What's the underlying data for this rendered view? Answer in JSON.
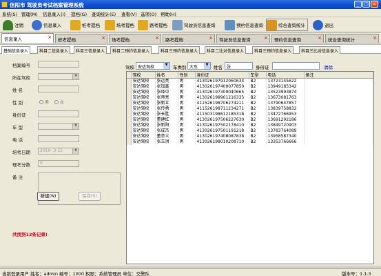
{
  "window": {
    "title": "信阳市  驾驶员考试档案管理系统"
  },
  "menu": [
    "系统(S)",
    "管理(M)",
    "信息录入(I)",
    "提档(G)",
    "查询统计(E)",
    "查看(V)",
    "选项(O)",
    "帮助(H)"
  ],
  "toolbar": [
    {
      "label": "注销",
      "icon": "logout-user-icon",
      "color": "#3d7d2a"
    },
    {
      "label": "信息录入",
      "icon": "user-entry-icon",
      "color": "#3a6fd1"
    },
    {
      "label": "桩考提档",
      "icon": "folder-icon",
      "color": "#e0a91f"
    },
    {
      "label": "场考提档",
      "icon": "folder-icon",
      "color": "#e0a91f"
    },
    {
      "label": "路考提档",
      "icon": "folder-icon",
      "color": "#e0a91f"
    },
    {
      "label": "驾驶员信息查询",
      "icon": "search-document-icon",
      "color": "#7b9ec2"
    },
    {
      "label": "预约信息查询",
      "icon": "calendar-icon",
      "color": "#5e8fbf"
    },
    {
      "label": "综合查询统计",
      "icon": "grid-stats-icon",
      "color": "#d99323"
    },
    {
      "label": "退出",
      "icon": "exit-icon",
      "color": "#2b62c8"
    }
  ],
  "main_tabs": [
    "信息录入",
    "桩考提档",
    "场考提档",
    "路考提档",
    "驾驶员信息查询",
    "预约信息查询",
    "统合查询统计"
  ],
  "sub_tabs": [
    "基础信息录入",
    "科目二信息录入",
    "科目三信息录入",
    "科目二预约信息录入",
    "科目三预约信息录入",
    "科目二比对信息录入",
    "科目三预约信息录入",
    "科目三比对信息录入"
  ],
  "form": {
    "labels": [
      "档案编号",
      "所在驾校",
      "姓    名",
      "性    别",
      "身份证",
      "车    型",
      "电    话",
      "培考日期",
      "理考分数",
      "备    注"
    ],
    "gender_male": "男",
    "gender_female": "女",
    "date_value": "2010- 3-15",
    "score_value": "0",
    "new_button": "新建(N)",
    "save_button": "保存(S)",
    "record_count": "共找到12条记录!"
  },
  "filter": {
    "school_label": "驾校",
    "school_value": "安达驾校",
    "cartype_label": "车类别",
    "cartype_value": "大车",
    "name_label": "姓名",
    "name_value": "张",
    "idcard_label": "身份证",
    "clear_label": "清除"
  },
  "grid": {
    "columns": [
      "驾校",
      "姓名",
      "性别",
      "身份证",
      "车型",
      "电话",
      "备注"
    ],
    "rows": [
      [
        "安达驾校",
        "张运亮",
        "男",
        "413026197912060634",
        "B2",
        "13723145622",
        ""
      ],
      [
        "安达驾校",
        "张加鑫",
        "男",
        "413026197409077850",
        "B2",
        "13949185342",
        ""
      ],
      [
        "安达驾校",
        "张绎中",
        "男",
        "413026197309040665",
        "B2",
        "13523993874",
        ""
      ],
      [
        "安达驾校",
        "张师亮",
        "男",
        "413026198901216335",
        "B2",
        "13673081763",
        ""
      ],
      [
        "安达驾校",
        "张新立",
        "男",
        "411526198706274211",
        "B2",
        "13790647857",
        ""
      ],
      [
        "安达驾校",
        "张传勇",
        "男",
        "411526198711234271",
        "B2",
        "13839758832",
        ""
      ],
      [
        "安达驾校",
        "张长胜",
        "男",
        "411503198612185318",
        "B2",
        "13472766953",
        ""
      ],
      [
        "安达驾校",
        "董建红",
        "男",
        "413026197506227630",
        "B2",
        "13691292186",
        ""
      ],
      [
        "安达驾校",
        "张新阳",
        "男",
        "413026197502178410",
        "B2",
        "13849720903",
        ""
      ],
      [
        "安达驾校",
        "张成杰",
        "男",
        "413026197501191218",
        "B2",
        "13783764089",
        ""
      ],
      [
        "安达驾校",
        "董意义",
        "男",
        "413026197408087838",
        "B2",
        "13958587340",
        ""
      ],
      [
        "安达驾校",
        "张玉洪",
        "男",
        "413026198010208710",
        "B2",
        "13353766666",
        ""
      ]
    ]
  },
  "status": {
    "left": "当前登录用户  姓名：admin  编号：1000  权限：系统管理员  单位：交警队",
    "right": "版本号：1.1.3"
  }
}
